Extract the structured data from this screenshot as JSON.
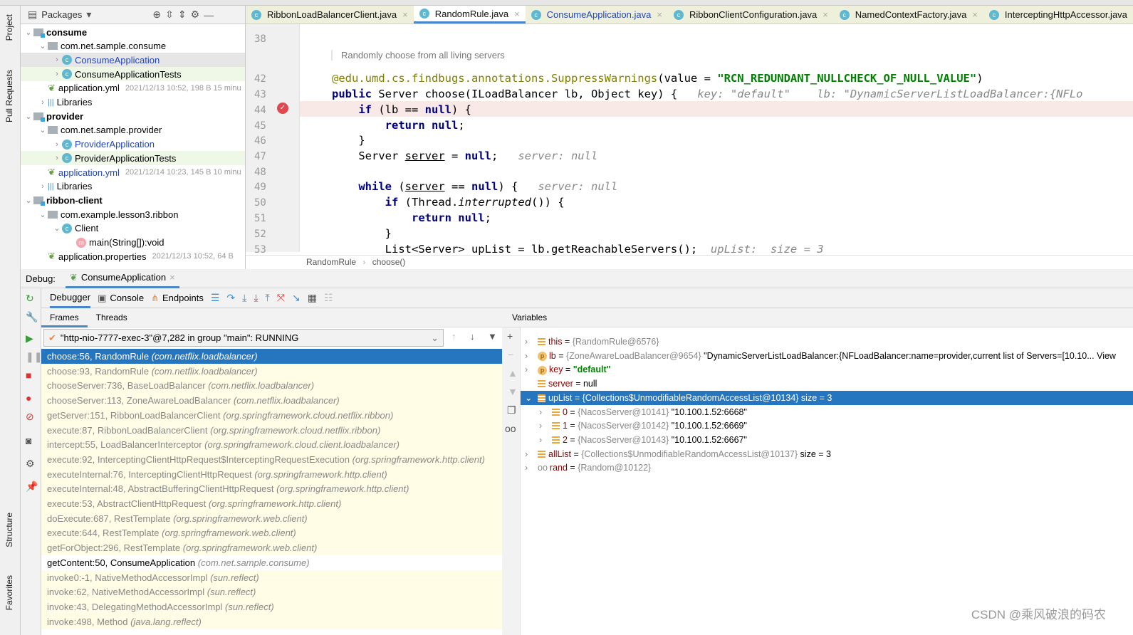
{
  "side_tabs": {
    "project": "Project",
    "pull_requests": "Pull Requests",
    "structure": "Structure",
    "favorites": "Favorites"
  },
  "project": {
    "title": "Packages",
    "tree": [
      {
        "label": "consume",
        "level": 0,
        "kind": "module",
        "open": true
      },
      {
        "label": "com.net.sample.consume",
        "level": 1,
        "kind": "pkg",
        "open": true
      },
      {
        "label": "ConsumeApplication",
        "level": 2,
        "kind": "class",
        "blue": true,
        "sel": true
      },
      {
        "label": "ConsumeApplicationTests",
        "level": 2,
        "kind": "class",
        "test": true
      },
      {
        "label": "application.yml",
        "level": 1,
        "kind": "yml",
        "meta": "2021/12/13 10:52, 198 B 15 minu"
      },
      {
        "label": "Libraries",
        "level": 1,
        "kind": "lib"
      },
      {
        "label": "provider",
        "level": 0,
        "kind": "module",
        "open": true
      },
      {
        "label": "com.net.sample.provider",
        "level": 1,
        "kind": "pkg",
        "open": true
      },
      {
        "label": "ProviderApplication",
        "level": 2,
        "kind": "class",
        "blue": true
      },
      {
        "label": "ProviderApplicationTests",
        "level": 2,
        "kind": "class",
        "test": true
      },
      {
        "label": "application.yml",
        "level": 1,
        "kind": "yml",
        "blue": true,
        "meta": "2021/12/14 10:23, 145 B 10 minu"
      },
      {
        "label": "Libraries",
        "level": 1,
        "kind": "lib"
      },
      {
        "label": "ribbon-client",
        "level": 0,
        "kind": "module",
        "open": true
      },
      {
        "label": "com.example.lesson3.ribbon",
        "level": 1,
        "kind": "pkg",
        "open": true
      },
      {
        "label": "Client",
        "level": 2,
        "kind": "class",
        "open": true
      },
      {
        "label": "main(String[]):void",
        "level": 3,
        "kind": "method"
      },
      {
        "label": "application.properties",
        "level": 1,
        "kind": "props",
        "meta": "2021/12/13 10:52, 64 B"
      }
    ]
  },
  "editor": {
    "tabs": [
      {
        "label": "RibbonLoadBalancerClient.java"
      },
      {
        "label": "RandomRule.java",
        "active": true
      },
      {
        "label": "ConsumeApplication.java",
        "blue": true
      },
      {
        "label": "RibbonClientConfiguration.java"
      },
      {
        "label": "NamedContextFactory.java"
      },
      {
        "label": "InterceptingHttpAccessor.java"
      }
    ],
    "doc_comment": "Randomly choose from all living servers",
    "lines": [
      {
        "n": "38",
        "tokens": []
      },
      {
        "n": "42",
        "tokens": [
          [
            "ann",
            "@edu.umd.cs.findbugs.annotations.SuppressWarnings"
          ],
          [
            "",
            "(value = "
          ],
          [
            "str",
            "\"RCN_REDUNDANT_NULLCHECK_OF_NULL_VALUE\""
          ],
          [
            "",
            ")"
          ]
        ]
      },
      {
        "n": "43",
        "tokens": [
          [
            "kw",
            "public"
          ],
          [
            "",
            " Server choose(ILoadBalancer lb, Object key) {   "
          ],
          [
            "hint",
            "key: \"default\"    lb: \"DynamicServerListLoadBalancer:{NFLo"
          ]
        ]
      },
      {
        "n": "44",
        "tokens": [
          [
            "",
            "    "
          ],
          [
            "kw",
            "if"
          ],
          [
            "",
            " (lb == "
          ],
          [
            "kw",
            "null"
          ],
          [
            "",
            ") {"
          ]
        ]
      },
      {
        "n": "45",
        "tokens": [
          [
            "",
            "        "
          ],
          [
            "kw",
            "return null"
          ],
          [
            "",
            ";"
          ]
        ]
      },
      {
        "n": "46",
        "tokens": [
          [
            "",
            "    }"
          ]
        ]
      },
      {
        "n": "47",
        "tokens": [
          [
            "",
            "    Server "
          ],
          [
            "und",
            "server"
          ],
          [
            "",
            " = "
          ],
          [
            "kw",
            "null"
          ],
          [
            "",
            ";   "
          ],
          [
            "hint",
            "server: null"
          ]
        ]
      },
      {
        "n": "48",
        "tokens": []
      },
      {
        "n": "49",
        "tokens": [
          [
            "",
            "    "
          ],
          [
            "kw",
            "while"
          ],
          [
            "",
            " ("
          ],
          [
            "und",
            "server"
          ],
          [
            "",
            " == "
          ],
          [
            "kw",
            "null"
          ],
          [
            "",
            ") {   "
          ],
          [
            "hint",
            "server: null"
          ]
        ]
      },
      {
        "n": "50",
        "tokens": [
          [
            "",
            "        "
          ],
          [
            "kw",
            "if"
          ],
          [
            "",
            " (Thread."
          ],
          [
            "ital",
            "interrupted"
          ],
          [
            "",
            "()) {"
          ]
        ]
      },
      {
        "n": "51",
        "tokens": [
          [
            "",
            "            "
          ],
          [
            "kw",
            "return null"
          ],
          [
            "",
            ";"
          ]
        ]
      },
      {
        "n": "52",
        "tokens": [
          [
            "",
            "        }"
          ]
        ]
      },
      {
        "n": "53",
        "tokens": [
          [
            "",
            "        List<Server> upList = lb.getReachableServers();  "
          ],
          [
            "hint",
            "upList:  size = 3"
          ]
        ]
      }
    ],
    "breadcrumb": [
      "RandomRule",
      "choose()"
    ]
  },
  "debug": {
    "label": "Debug:",
    "config": "ConsumeApplication",
    "tabs": {
      "debugger": "Debugger",
      "console": "Console",
      "endpoints": "Endpoints"
    },
    "frames_tab": "Frames",
    "threads_tab": "Threads",
    "thread": "\"http-nio-7777-exec-3\"@7,282 in group \"main\": RUNNING",
    "frames": [
      {
        "m": "choose:56, RandomRule",
        "p": "(com.netflix.loadbalancer)",
        "sel": true
      },
      {
        "m": "choose:93, RandomRule",
        "p": "(com.netflix.loadbalancer)"
      },
      {
        "m": "chooseServer:736, BaseLoadBalancer",
        "p": "(com.netflix.loadbalancer)"
      },
      {
        "m": "chooseServer:113, ZoneAwareLoadBalancer",
        "p": "(com.netflix.loadbalancer)"
      },
      {
        "m": "getServer:151, RibbonLoadBalancerClient",
        "p": "(org.springframework.cloud.netflix.ribbon)"
      },
      {
        "m": "execute:87, RibbonLoadBalancerClient",
        "p": "(org.springframework.cloud.netflix.ribbon)"
      },
      {
        "m": "intercept:55, LoadBalancerInterceptor",
        "p": "(org.springframework.cloud.client.loadbalancer)"
      },
      {
        "m": "execute:92, InterceptingClientHttpRequest$InterceptingRequestExecution",
        "p": "(org.springframework.http.client)"
      },
      {
        "m": "executeInternal:76, InterceptingClientHttpRequest",
        "p": "(org.springframework.http.client)"
      },
      {
        "m": "executeInternal:48, AbstractBufferingClientHttpRequest",
        "p": "(org.springframework.http.client)"
      },
      {
        "m": "execute:53, AbstractClientHttpRequest",
        "p": "(org.springframework.http.client)"
      },
      {
        "m": "doExecute:687, RestTemplate",
        "p": "(org.springframework.web.client)"
      },
      {
        "m": "execute:644, RestTemplate",
        "p": "(org.springframework.web.client)"
      },
      {
        "m": "getForObject:296, RestTemplate",
        "p": "(org.springframework.web.client)"
      },
      {
        "m": "getContent:50, ConsumeApplication",
        "p": "(com.net.sample.consume)",
        "user": true
      },
      {
        "m": "invoke0:-1, NativeMethodAccessorImpl",
        "p": "(sun.reflect)"
      },
      {
        "m": "invoke:62, NativeMethodAccessorImpl",
        "p": "(sun.reflect)"
      },
      {
        "m": "invoke:43, DelegatingMethodAccessorImpl",
        "p": "(sun.reflect)"
      },
      {
        "m": "invoke:498, Method",
        "p": "(java.lang.reflect)"
      }
    ],
    "variables_title": "Variables",
    "variables": [
      {
        "lvl": 0,
        "icon": "field",
        "name": "this",
        "type": "{RandomRule@6576}",
        "val": "",
        "exp": true
      },
      {
        "lvl": 0,
        "icon": "param",
        "name": "lb",
        "type": "{ZoneAwareLoadBalancer@9654}",
        "val": " \"DynamicServerListLoadBalancer:{NFLoadBalancer:name=provider,current list of Servers=[10.10... View",
        "exp": true
      },
      {
        "lvl": 0,
        "icon": "param",
        "name": "key",
        "type": "",
        "val": "\"default\"",
        "str": true,
        "exp": true
      },
      {
        "lvl": 0,
        "icon": "field",
        "name": "server",
        "type": "",
        "val": "null"
      },
      {
        "lvl": 0,
        "icon": "field",
        "name": "upList",
        "type": "{Collections$UnmodifiableRandomAccessList@10134}",
        "val": "  size = 3",
        "sel": true,
        "open": true
      },
      {
        "lvl": 1,
        "icon": "field",
        "name": "0",
        "type": "{NacosServer@10141}",
        "val": " \"10.100.1.52:6668\"",
        "exp": true
      },
      {
        "lvl": 1,
        "icon": "field",
        "name": "1",
        "type": "{NacosServer@10142}",
        "val": " \"10.100.1.52:6669\"",
        "exp": true
      },
      {
        "lvl": 1,
        "icon": "field",
        "name": "2",
        "type": "{NacosServer@10143}",
        "val": " \"10.100.1.52:6667\"",
        "exp": true
      },
      {
        "lvl": 0,
        "icon": "field",
        "name": "allList",
        "type": "{Collections$UnmodifiableRandomAccessList@10137}",
        "val": "  size = 3",
        "exp": true
      },
      {
        "lvl": 0,
        "icon": "watch",
        "name": "rand",
        "type": "{Random@10122}",
        "val": "",
        "exp": true
      }
    ]
  },
  "watermark": "CSDN @乘风破浪的码农"
}
